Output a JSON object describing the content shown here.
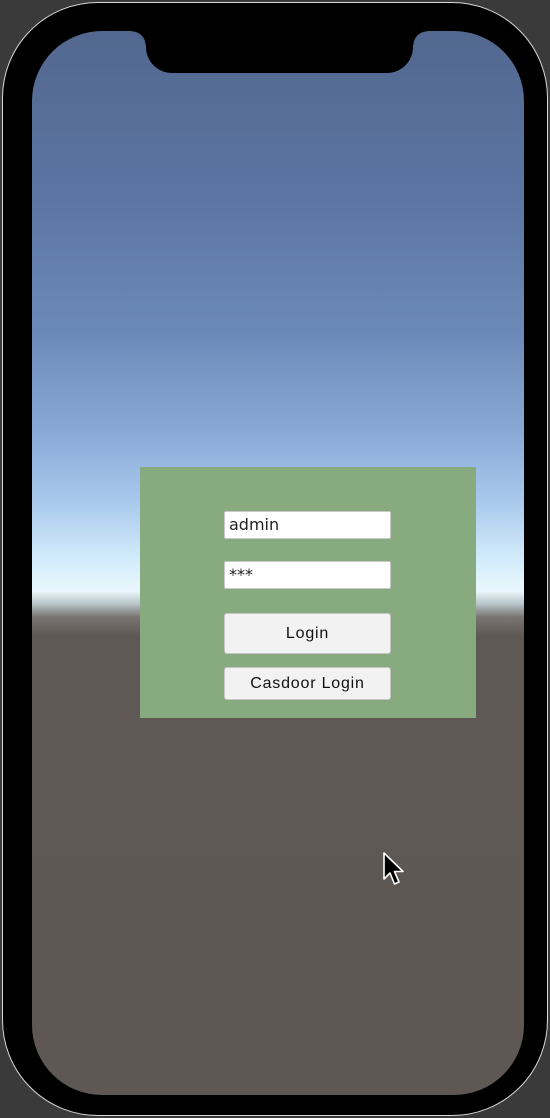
{
  "login_form": {
    "username_value": "admin",
    "password_value": "***",
    "login_button_label": "Login",
    "casdoor_login_button_label": "Casdoor Login"
  },
  "cursor": {
    "icon": "mouse-pointer-icon"
  },
  "colors": {
    "panel_background": "#87aa7e",
    "sky_top": "#53688f",
    "ground": "#5e5754",
    "device_frame": "#000000"
  }
}
